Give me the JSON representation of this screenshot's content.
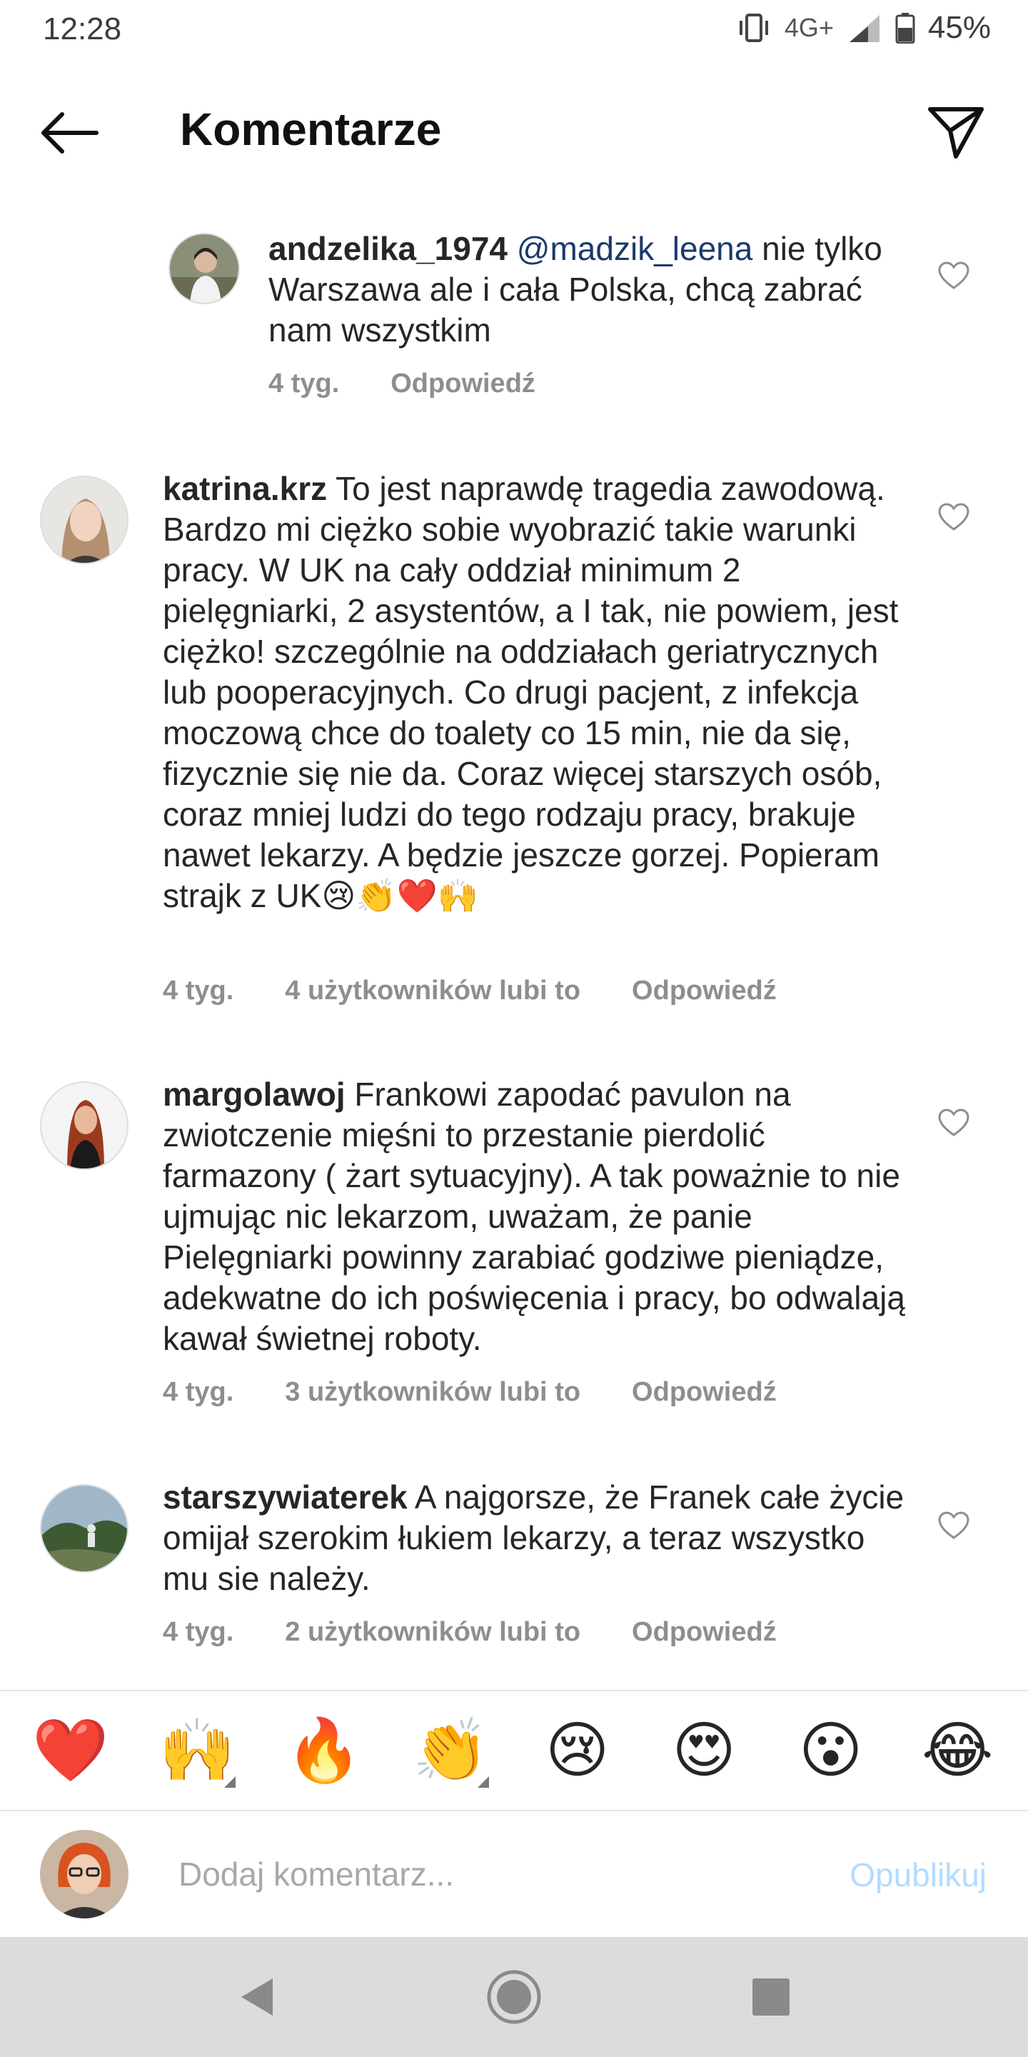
{
  "status": {
    "time": "12:28",
    "network": "4G+",
    "battery": "45%"
  },
  "header": {
    "title": "Komentarze"
  },
  "comments": [
    {
      "user": "andzelika_1974",
      "mention": "@madzik_leena",
      "text": " nie tylko Warszawa ale i cała Polska, chcą zabrać nam wszystkim",
      "time": "4 tyg.",
      "likes": "",
      "reply": "Odpowiedź"
    },
    {
      "user": "katrina.krz",
      "text": " To jest naprawdę tragedia zawodową. Bardzo mi ciężko sobie wyobrazić takie warunki pracy. W UK na cały oddział minimum 2 pielęgniarki, 2 asystentów, a I tak, nie powiem, jest ciężko! szczególnie na oddziałach geriatrycznych lub pooperacyjnych. Co drugi pacjent, z infekcja moczową chce do toalety co 15 min, nie da się, fizycznie się nie da. Coraz więcej starszych osób, coraz mniej ludzi do tego rodzaju pracy, brakuje nawet lekarzy. A będzie jeszcze gorzej. Popieram strajk z UK😢👏❤️🙌",
      "time": "4 tyg.",
      "likes": "4 użytkowników lubi to",
      "reply": "Odpowiedź"
    },
    {
      "user": "margolawoj",
      "text": " Frankowi zapodać pavulon na zwiotczenie mięśni to przestanie pierdolić farmazony ( żart sytuacyjny). A tak poważnie to nie ujmując nic lekarzom, uważam, że panie Pielęgniarki powinny zarabiać godziwe pieniądze, adekwatne do ich poświęcenia i pracy, bo odwalają kawał świetnej roboty.",
      "time": "4 tyg.",
      "likes": "3 użytkowników lubi to",
      "reply": "Odpowiedź"
    },
    {
      "user": "starszywiaterek",
      "text": " A najgorsze, że Franek całe życie omijał szerokim łukiem lekarzy, a teraz wszystko mu sie należy.",
      "time": "4 tyg.",
      "likes": "2 użytkowników lubi to",
      "reply": "Odpowiedź"
    }
  ],
  "emoji_bar": [
    "❤️",
    "🙌",
    "🔥",
    "👏",
    "😢",
    "😍",
    "😮",
    "😂"
  ],
  "composer": {
    "placeholder": "Dodaj komentarz...",
    "publish": "Opublikuj"
  },
  "icons": {
    "back": "arrow-left-icon",
    "send": "paper-plane-icon",
    "like": "heart-outline-icon",
    "nav_back": "triangle-back-icon",
    "nav_home": "circle-home-icon",
    "nav_recent": "square-recent-icon"
  }
}
